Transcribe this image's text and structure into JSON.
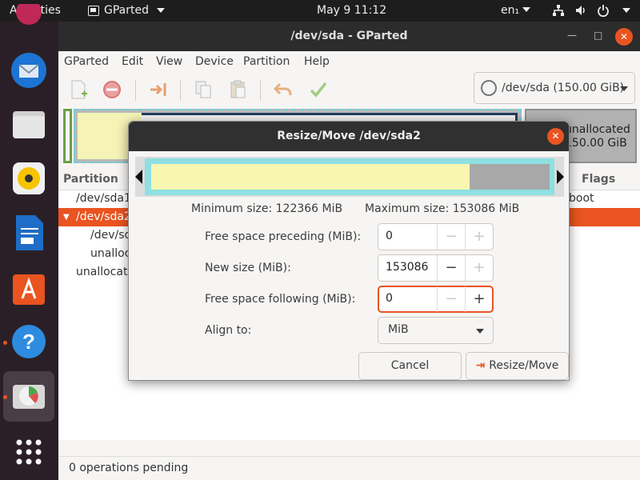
{
  "topbar": {
    "activities": "Activities",
    "app_name": "GParted",
    "clock": "May 9  11:12",
    "lang": "en₁"
  },
  "window": {
    "title": "/dev/sda - GParted",
    "menu": [
      "GParted",
      "Edit",
      "View",
      "Device",
      "Partition",
      "Help"
    ],
    "device_selector": "/dev/sda (150.00 GiB)"
  },
  "diskmap": {
    "unallocated_label": "unallocated",
    "unallocated_size": "150.00 GiB"
  },
  "partitions": {
    "headers": {
      "partition": "Partition",
      "flags": "Flags"
    },
    "rows": [
      {
        "name": "/dev/sda1",
        "flags": "boot",
        "selected": false
      },
      {
        "name": "/dev/sda2",
        "flags": "",
        "selected": true
      },
      {
        "name": "/dev/sda5",
        "flags": "",
        "selected": false
      },
      {
        "name": "unallocated",
        "flags": "",
        "selected": false
      },
      {
        "name": "unallocated",
        "flags": "",
        "selected": false
      }
    ]
  },
  "status": "0 operations pending",
  "dialog": {
    "title": "Resize/Move /dev/sda2",
    "min_size": "Minimum size: 122366 MiB",
    "max_size": "Maximum size: 153086 MiB",
    "fields": {
      "preceding_label": "Free space preceding (MiB):",
      "preceding_value": "0",
      "new_size_label": "New size (MiB):",
      "new_size_value": "153086",
      "following_label": "Free space following (MiB):",
      "following_value": "0",
      "align_label": "Align to:",
      "align_value": "MiB"
    },
    "cancel": "Cancel",
    "resize_move": "Resize/Move"
  }
}
